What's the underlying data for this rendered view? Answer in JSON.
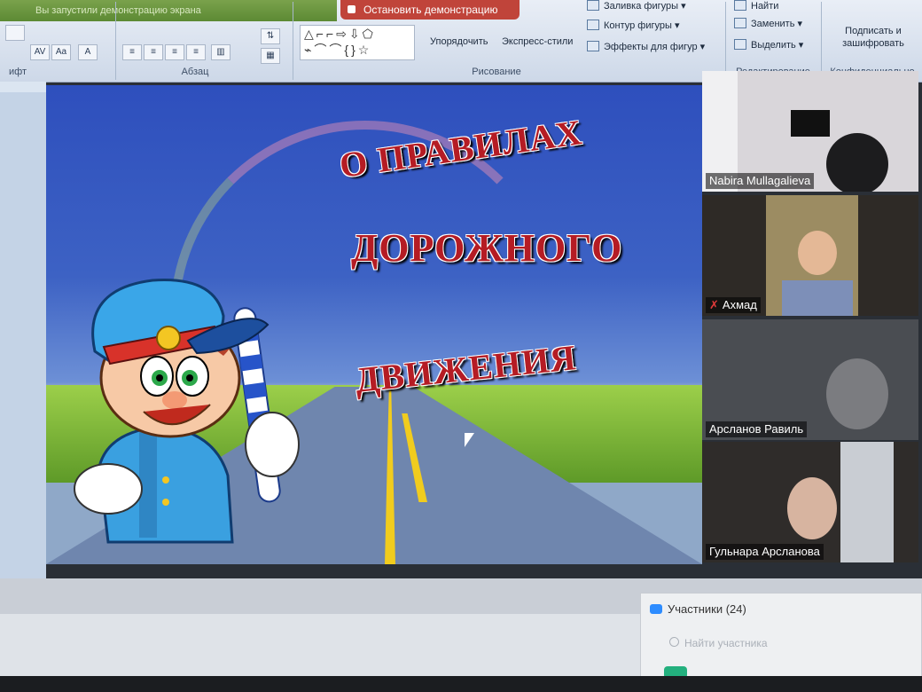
{
  "ribbon": {
    "status_text": "Вы запустили демонстрацию экрана",
    "stop_demo": "Остановить демонстрацию",
    "fill_shape": "Заливка фигуры",
    "outline_shape": "Контур фигуры",
    "effects_shape": "Эффекты для фигур",
    "arrange": "Упорядочить",
    "quick_styles": "Экспресс-стили",
    "find": "Найти",
    "replace": "Заменить",
    "select": "Выделить",
    "sign_encrypt": "Подписать и зашифровать",
    "group_font": "ифт",
    "group_paragraph": "Абзац",
    "group_drawing": "Рисование",
    "group_editing": "Редактирование",
    "group_privacy": "Конфиденциально",
    "shape_glyphs": "△⌐⌐⇨⇩⬠ ⌁⌒⌒{}☆"
  },
  "slide": {
    "line1": "О ПРАВИЛАХ",
    "line2": "ДОРОЖНОГО",
    "line3": "ДВИЖЕНИЯ"
  },
  "participants": [
    {
      "name": "Nabira Mullagalieva",
      "muted": false
    },
    {
      "name": "Ахмад",
      "muted": true
    },
    {
      "name": "Арсланов Равиль",
      "muted": false
    },
    {
      "name": "Гульнара Арсланова",
      "muted": false
    }
  ],
  "panel": {
    "title": "Участники (24)",
    "search_placeholder": "Найти участника"
  },
  "colors": {
    "demo_bar": "#c0443a",
    "title_red": "#b51c24",
    "zoom_blue": "#2d8cff"
  }
}
